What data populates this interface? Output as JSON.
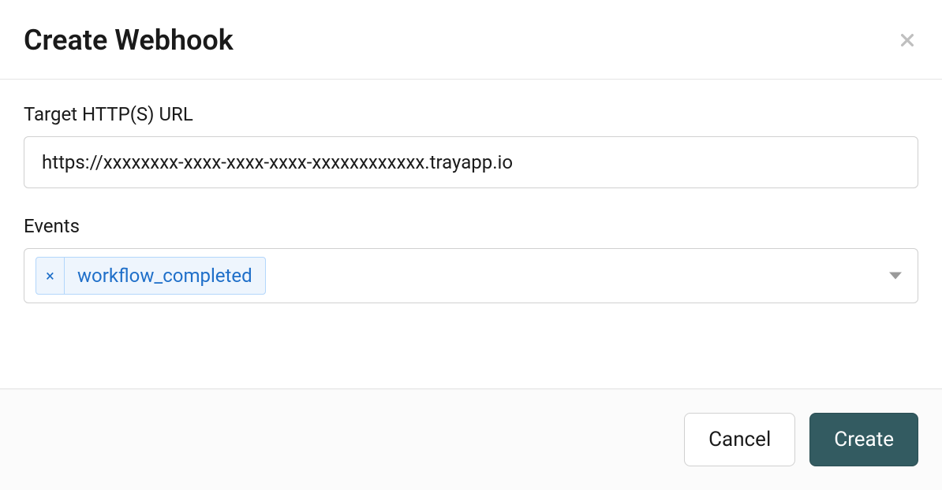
{
  "modal": {
    "title": "Create Webhook"
  },
  "fields": {
    "url": {
      "label": "Target HTTP(S) URL",
      "value": "https://xxxxxxxx-xxxx-xxxx-xxxx-xxxxxxxxxxxx.trayapp.io"
    },
    "events": {
      "label": "Events",
      "selected": [
        {
          "label": "workflow_completed"
        }
      ]
    }
  },
  "footer": {
    "cancel": "Cancel",
    "create": "Create"
  }
}
